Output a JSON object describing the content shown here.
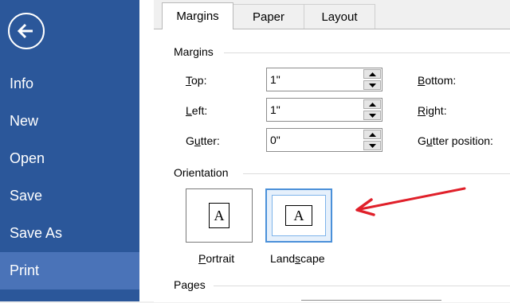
{
  "sidebar": {
    "back_icon": "back-arrow-icon",
    "items": [
      {
        "label": "Info"
      },
      {
        "label": "New"
      },
      {
        "label": "Open"
      },
      {
        "label": "Save"
      },
      {
        "label": "Save As"
      },
      {
        "label": "Print",
        "selected": true
      }
    ]
  },
  "tabs": [
    {
      "label": "Margins",
      "active": true
    },
    {
      "label": "Paper"
    },
    {
      "label": "Layout"
    }
  ],
  "margins": {
    "section_label": "Margins",
    "top": {
      "label_key": "T",
      "label_rest": "op:",
      "value": "1\""
    },
    "left": {
      "label_key": "L",
      "label_rest": "eft:",
      "value": "1\""
    },
    "gutter": {
      "label_pre": "G",
      "label_key": "u",
      "label_rest": "tter:",
      "value": "0\""
    },
    "bottom": {
      "label_key": "B",
      "label_rest": "ottom:"
    },
    "right": {
      "label_key": "R",
      "label_rest": "ight:"
    },
    "gutter_position": {
      "label_pre": "G",
      "label_key": "u",
      "label_rest": "tter position:"
    }
  },
  "orientation": {
    "section_label": "Orientation",
    "portrait": {
      "label_key": "P",
      "label_rest": "ortrait",
      "glyph": "A"
    },
    "landscape": {
      "label_pre": "Land",
      "label_key": "s",
      "label_rest": "cape",
      "glyph": "A",
      "selected": true
    }
  },
  "pages": {
    "section_label": "Pages"
  },
  "colors": {
    "sidebar_bg": "#2b579a",
    "sidebar_selected": "#4a73b8",
    "annotation_arrow": "#e0202a",
    "selection_border": "#4a90d9"
  }
}
